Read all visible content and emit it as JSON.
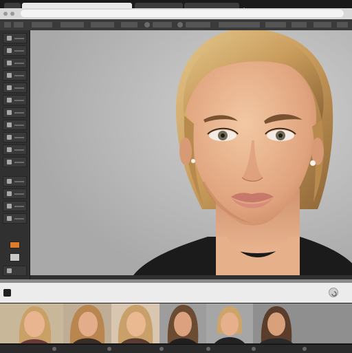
{
  "window": {
    "tabs": [
      {
        "label": "",
        "active": true
      },
      {
        "label": "",
        "active": false
      },
      {
        "label": "",
        "active": false
      }
    ],
    "address_bar": {
      "value": ""
    }
  },
  "toolbar": {
    "items": [
      "",
      "",
      "",
      "",
      "",
      "",
      "",
      "",
      ""
    ]
  },
  "left_panel": {
    "tools": [
      "move",
      "marquee",
      "lasso",
      "crop",
      "eyedropper",
      "brush",
      "clone",
      "eraser",
      "gradient",
      "dodge",
      "pen",
      "type",
      "hand",
      "zoom"
    ],
    "colors": {
      "foreground": "#e07b2a",
      "background": "#c8c8c8"
    }
  },
  "canvas": {
    "subject": "portrait",
    "background_color": "#bcbcbc"
  },
  "filmstrip_header": {
    "title": "",
    "center_label": "",
    "right_label": ""
  },
  "filmstrip": {
    "thumbnails": [
      {
        "name": "portrait-thumb-1",
        "bg": "#c9b79a"
      },
      {
        "name": "portrait-thumb-2",
        "bg": "#bfae95"
      },
      {
        "name": "portrait-thumb-3",
        "bg": "#d8c6b0"
      },
      {
        "name": "portrait-thumb-4",
        "bg": "#9d9d9d"
      },
      {
        "name": "portrait-thumb-5",
        "bg": "#a6a6a6"
      },
      {
        "name": "portrait-thumb-6",
        "bg": "#8f8f8f"
      }
    ]
  },
  "colors": {
    "accent_orange": "#e07b2a",
    "panel_dark": "#303030",
    "toolbar_dark": "#3a3a3a",
    "header_light": "#ececec"
  }
}
